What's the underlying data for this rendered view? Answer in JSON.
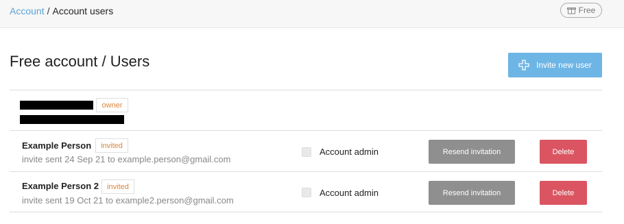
{
  "breadcrumb": {
    "link": "Account",
    "separator": "/",
    "current": "Account users"
  },
  "plan_badge": {
    "label": "Free",
    "icon": "gift-icon"
  },
  "page_title": "Free account / Users",
  "invite_button": {
    "label": "Invite new user",
    "icon": "plus-icon"
  },
  "owner": {
    "name": "[redacted]",
    "email": "[redacted]",
    "tag": "owner"
  },
  "users": [
    {
      "name": "Example Person",
      "tag": "invited",
      "sub": "invite sent 24 Sep 21 to example.person@gmail.com",
      "admin_label": "Account admin",
      "admin_checked": false,
      "resend_label": "Resend invitation",
      "delete_label": "Delete"
    },
    {
      "name": "Example Person 2",
      "tag": "invited",
      "sub": "invite sent 19 Oct 21 to example2.person@gmail.com",
      "admin_label": "Account admin",
      "admin_checked": false,
      "resend_label": "Resend invitation",
      "delete_label": "Delete"
    }
  ],
  "colors": {
    "link": "#5ba4d8",
    "primary": "#6db5e5",
    "danger": "#da5561",
    "neutral_button": "#8f8f8f",
    "tag_text": "#d9853b"
  }
}
